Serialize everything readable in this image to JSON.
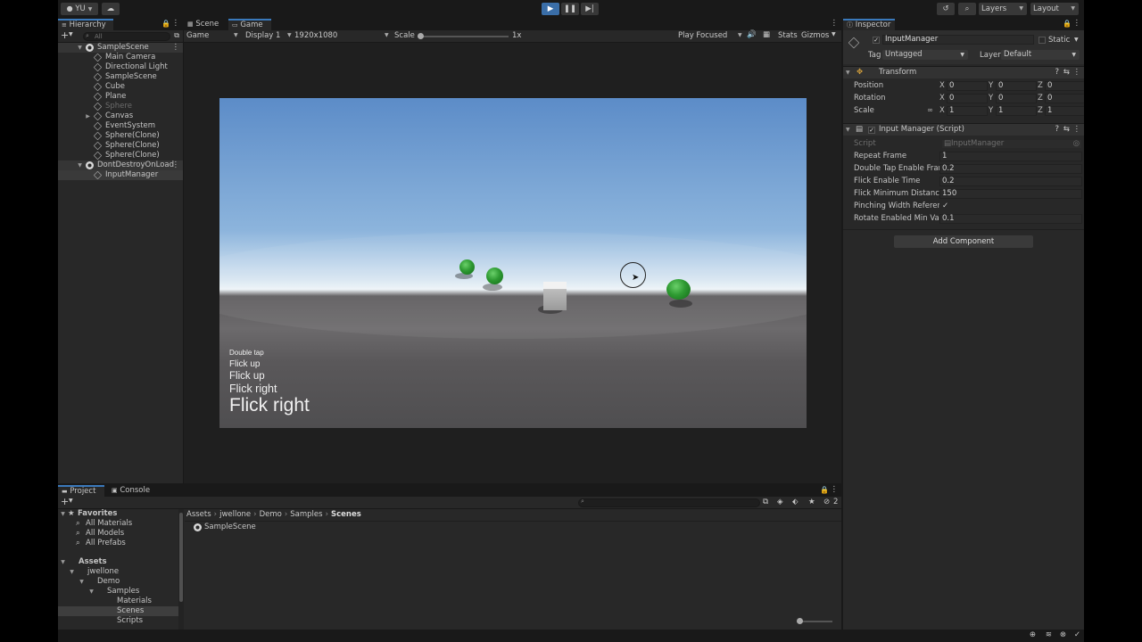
{
  "toolbar": {
    "account": "YU",
    "layers": "Layers",
    "layout": "Layout"
  },
  "hierarchy": {
    "tab": "Hierarchy",
    "search_placeholder": "All",
    "items": [
      {
        "label": "SampleScene",
        "type": "scene"
      },
      {
        "label": "Main Camera",
        "type": "object"
      },
      {
        "label": "Directional Light",
        "type": "object"
      },
      {
        "label": "SampleScene",
        "type": "object"
      },
      {
        "label": "Cube",
        "type": "object"
      },
      {
        "label": "Plane",
        "type": "object"
      },
      {
        "label": "Sphere",
        "type": "disabled"
      },
      {
        "label": "Canvas",
        "type": "object"
      },
      {
        "label": "EventSystem",
        "type": "object"
      },
      {
        "label": "Sphere(Clone)",
        "type": "object"
      },
      {
        "label": "Sphere(Clone)",
        "type": "object"
      },
      {
        "label": "Sphere(Clone)",
        "type": "object"
      },
      {
        "label": "DontDestroyOnLoad",
        "type": "scene"
      },
      {
        "label": "InputManager",
        "type": "selected"
      }
    ]
  },
  "game": {
    "tabs": [
      "Scene",
      "Game"
    ],
    "mode": "Game",
    "display": "Display 1",
    "resolution": "1920x1080",
    "scale_label": "Scale",
    "scale_value": "1x",
    "play_focused": "Play Focused",
    "stats": "Stats",
    "gizmos": "Gizmos",
    "overlay_lines": [
      "Double tap",
      "Flick up",
      "Flick up",
      "Flick right",
      "Flick right"
    ]
  },
  "inspector": {
    "tab": "Inspector",
    "object_name": "InputManager",
    "static_label": "Static",
    "tag_label": "Tag",
    "tag_value": "Untagged",
    "layer_label": "Layer",
    "layer_value": "Default",
    "transform": {
      "title": "Transform",
      "rows": [
        {
          "label": "Position",
          "x": "0",
          "y": "0",
          "z": "0"
        },
        {
          "label": "Rotation",
          "x": "0",
          "y": "0",
          "z": "0"
        },
        {
          "label": "Scale",
          "x": "1",
          "y": "1",
          "z": "1"
        }
      ]
    },
    "script_component": {
      "title": "Input Manager (Script)",
      "script_label": "Script",
      "script_value": "InputManager",
      "fields": [
        {
          "label": "Repeat Frame",
          "value": "1"
        },
        {
          "label": "Double Tap Enable Fram",
          "value": "0.2"
        },
        {
          "label": "Flick Enable Time",
          "value": "0.2"
        },
        {
          "label": "Flick Minimum Distance",
          "value": "150"
        },
        {
          "label": "Pinching Width Referenc",
          "value": "✓"
        },
        {
          "label": "Rotate Enabled Min Valu",
          "value": "0.1"
        }
      ]
    },
    "add_component": "Add Component"
  },
  "project": {
    "tabs": [
      "Project",
      "Console"
    ],
    "count_badge": "2",
    "favorites_label": "Favorites",
    "favorites": [
      "All Materials",
      "All Models",
      "All Prefabs"
    ],
    "assets_label": "Assets",
    "tree": [
      "jwellone",
      "Demo",
      "Samples",
      "Materials",
      "Scenes",
      "Scripts"
    ],
    "breadcrumb": [
      "Assets",
      "jwellone",
      "Demo",
      "Samples",
      "Scenes"
    ],
    "files": [
      "SampleScene"
    ]
  }
}
